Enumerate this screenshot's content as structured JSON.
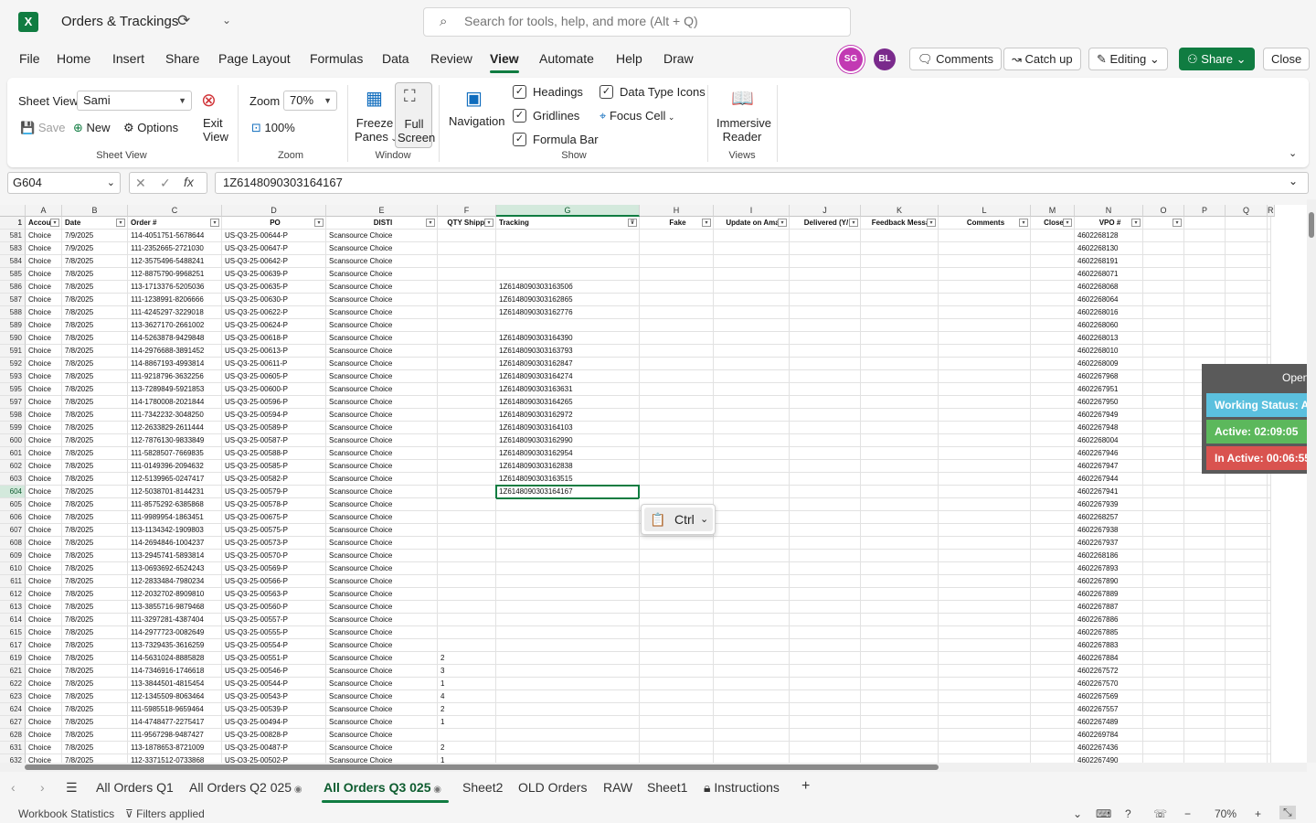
{
  "app": {
    "title": "Orders & Trackings",
    "search_placeholder": "Search for tools, help, and more (Alt + Q)"
  },
  "menu": [
    "File",
    "Home",
    "Insert",
    "Share",
    "Page Layout",
    "Formulas",
    "Data",
    "Review",
    "View",
    "Automate",
    "Help",
    "Draw"
  ],
  "header": {
    "avatar1": "SG",
    "avatar2": "BL",
    "comments": "Comments",
    "catchup": "Catch up",
    "editing": "Editing",
    "share": "Share",
    "close": "Close"
  },
  "ribbon": {
    "sheet_view_label": "Sheet View",
    "sheet_view_value": "Sami",
    "save": "Save",
    "new": "New",
    "options": "Options",
    "exit1": "Exit",
    "exit2": "View",
    "group_sheet_view": "Sheet View",
    "zoom_label": "Zoom",
    "zoom_value": "70%",
    "zoom_100": "100%",
    "group_zoom": "Zoom",
    "freeze1": "Freeze",
    "freeze2": "Panes",
    "full1": "Full",
    "full2": "Screen",
    "group_window": "Window",
    "navigation": "Navigation",
    "headings": "Headings",
    "gridlines": "Gridlines",
    "formula_bar": "Formula Bar",
    "data_type_icons": "Data Type Icons",
    "focus_cell": "Focus Cell",
    "group_show": "Show",
    "immersive1": "Immersive",
    "immersive2": "Reader",
    "group_views": "Views"
  },
  "formula_bar": {
    "name_box": "G604",
    "value": "1Z6148090303164167"
  },
  "grid": {
    "columns": [
      "A",
      "B",
      "C",
      "D",
      "E",
      "F",
      "G",
      "H",
      "I",
      "J",
      "K",
      "L",
      "M",
      "N",
      "O",
      "P",
      "Q",
      "R"
    ],
    "header_row_num": "1",
    "headers": [
      "Accou",
      "Date",
      "Order #",
      "PO",
      "DISTI",
      "QTY Shippe",
      "Tracking",
      "Fake",
      "Update on Ama",
      "Delivered (Y/",
      "Feedback Messa",
      "Comments",
      "Close",
      "VPO #",
      "",
      "",
      "",
      ""
    ],
    "active_row": "604",
    "rows": [
      [
        "581",
        "Choice",
        "7/9/2025",
        "114-4051751-5678644",
        "US-Q3-25-00644-P",
        "Scansource Choice",
        "",
        "",
        "4602268128"
      ],
      [
        "583",
        "Choice",
        "7/9/2025",
        "111-2352665-2721030",
        "US-Q3-25-00647-P",
        "Scansource Choice",
        "",
        "",
        "4602268130"
      ],
      [
        "584",
        "Choice",
        "7/8/2025",
        "112-3575496-5488241",
        "US-Q3-25-00642-P",
        "Scansource Choice",
        "",
        "",
        "4602268191"
      ],
      [
        "585",
        "Choice",
        "7/8/2025",
        "112-8875790-9968251",
        "US-Q3-25-00639-P",
        "Scansource Choice",
        "",
        "",
        "4602268071"
      ],
      [
        "586",
        "Choice",
        "7/8/2025",
        "113-1713376-5205036",
        "US-Q3-25-00635-P",
        "Scansource Choice",
        "",
        "1Z614809030316350б",
        "4602268068"
      ],
      [
        "587",
        "Choice",
        "7/8/2025",
        "111-1238991-8206666",
        "US-Q3-25-00630-P",
        "Scansource Choice",
        "",
        "1Z6148090303162865",
        "4602268064"
      ],
      [
        "588",
        "Choice",
        "7/8/2025",
        "111-4245297-3229018",
        "US-Q3-25-00622-P",
        "Scansource Choice",
        "",
        "1Z6148090303162776",
        "4602268016"
      ],
      [
        "589",
        "Choice",
        "7/8/2025",
        "113-3627170-2661002",
        "US-Q3-25-00624-P",
        "Scansource Choice",
        "",
        "",
        "4602268060"
      ],
      [
        "590",
        "Choice",
        "7/8/2025",
        "114-5263878-9429848",
        "US-Q3-25-00618-P",
        "Scansource Choice",
        "",
        "1Z6148090303164390",
        "4602268013"
      ],
      [
        "591",
        "Choice",
        "7/8/2025",
        "114-2976688-3891452",
        "US-Q3-25-00613-P",
        "Scansource Choice",
        "",
        "1Z6148090303163793",
        "4602268010"
      ],
      [
        "592",
        "Choice",
        "7/8/2025",
        "114-8867193-4993814",
        "US-Q3-25-00611-P",
        "Scansource Choice",
        "",
        "1Z6148090303162847",
        "4602268009"
      ],
      [
        "593",
        "Choice",
        "7/8/2025",
        "111-9218796-3632256",
        "US-Q3-25-00605-P",
        "Scansource Choice",
        "",
        "1Z6148090303164274",
        "4602267968"
      ],
      [
        "595",
        "Choice",
        "7/8/2025",
        "113-7289849-5921853",
        "US-Q3-25-00600-P",
        "Scansource Choice",
        "",
        "1Z6148090303163631",
        "4602267951"
      ],
      [
        "597",
        "Choice",
        "7/8/2025",
        "114-1780008-2021844",
        "US-Q3-25-00596-P",
        "Scansource Choice",
        "",
        "1Z6148090303164265",
        "4602267950"
      ],
      [
        "598",
        "Choice",
        "7/8/2025",
        "111-7342232-3048250",
        "US-Q3-25-00594-P",
        "Scansource Choice",
        "",
        "1Z6148090303162972",
        "4602267949"
      ],
      [
        "599",
        "Choice",
        "7/8/2025",
        "112-2633829-2611444",
        "US-Q3-25-00589-P",
        "Scansource Choice",
        "",
        "1Z6148090303164103",
        "4602267948"
      ],
      [
        "600",
        "Choice",
        "7/8/2025",
        "112-7876130-9833849",
        "US-Q3-25-00587-P",
        "Scansource Choice",
        "",
        "1Z6148090303162990",
        "4602268004"
      ],
      [
        "601",
        "Choice",
        "7/8/2025",
        "111-5828507-7669835",
        "US-Q3-25-00588-P",
        "Scansource Choice",
        "",
        "1Z6148090303162954",
        "4602267946"
      ],
      [
        "602",
        "Choice",
        "7/8/2025",
        "111-0149396-2094632",
        "US-Q3-25-00585-P",
        "Scansource Choice",
        "",
        "1Z6148090303162838",
        "4602267947"
      ],
      [
        "603",
        "Choice",
        "7/8/2025",
        "112-5139965-0247417",
        "US-Q3-25-00582-P",
        "Scansource Choice",
        "",
        "1Z6148090303163515",
        "4602267944"
      ],
      [
        "604",
        "Choice",
        "7/8/2025",
        "112-5038701-8144231",
        "US-Q3-25-00579-P",
        "Scansource Choice",
        "",
        "1Z6148090303164167",
        "4602267941"
      ],
      [
        "605",
        "Choice",
        "7/8/2025",
        "111-8575292-6385868",
        "US-Q3-25-00578-P",
        "Scansource Choice",
        "",
        "",
        "4602267939"
      ],
      [
        "606",
        "Choice",
        "7/8/2025",
        "111-9989954-1863451",
        "US-Q3-25-00675-P",
        "Scansource Choice",
        "",
        "",
        "4602268257"
      ],
      [
        "607",
        "Choice",
        "7/8/2025",
        "113-1134342-1909803",
        "US-Q3-25-00575-P",
        "Scansource Choice",
        "",
        "",
        "4602267938"
      ],
      [
        "608",
        "Choice",
        "7/8/2025",
        "114-2694846-1004237",
        "US-Q3-25-00573-P",
        "Scansource Choice",
        "",
        "",
        "4602267937"
      ],
      [
        "609",
        "Choice",
        "7/8/2025",
        "113-2945741-5893814",
        "US-Q3-25-00570-P",
        "Scansource Choice",
        "",
        "",
        "4602268186"
      ],
      [
        "610",
        "Choice",
        "7/8/2025",
        "113-0693692-6524243",
        "US-Q3-25-00569-P",
        "Scansource Choice",
        "",
        "",
        "4602267893"
      ],
      [
        "611",
        "Choice",
        "7/8/2025",
        "112-2833484-7980234",
        "US-Q3-25-00566-P",
        "Scansource Choice",
        "",
        "",
        "4602267890"
      ],
      [
        "612",
        "Choice",
        "7/8/2025",
        "112-2032702-8909810",
        "US-Q3-25-00563-P",
        "Scansource Choice",
        "",
        "",
        "4602267889"
      ],
      [
        "613",
        "Choice",
        "7/8/2025",
        "113-3855716-9879468",
        "US-Q3-25-00560-P",
        "Scansource Choice",
        "",
        "",
        "4602267887"
      ],
      [
        "614",
        "Choice",
        "7/8/2025",
        "111-3297281-4387404",
        "US-Q3-25-00557-P",
        "Scansource Choice",
        "",
        "",
        "4602267886"
      ],
      [
        "615",
        "Choice",
        "7/8/2025",
        "114-2977723-0082649",
        "US-Q3-25-00555-P",
        "Scansource Choice",
        "",
        "",
        "4602267885"
      ],
      [
        "617",
        "Choice",
        "7/8/2025",
        "113-7329435-3616259",
        "US-Q3-25-00554-P",
        "Scansource Choice",
        "",
        "",
        "4602267883"
      ],
      [
        "619",
        "Choice",
        "7/8/2025",
        "114-5631024-8885828",
        "US-Q3-25-00551-P",
        "Scansource Choice",
        "2",
        "",
        "4602267884"
      ],
      [
        "621",
        "Choice",
        "7/8/2025",
        "114-7346916-1746618",
        "US-Q3-25-00546-P",
        "Scansource Choice",
        "3",
        "",
        "4602267572"
      ],
      [
        "622",
        "Choice",
        "7/8/2025",
        "113-3844501-4815454",
        "US-Q3-25-00544-P",
        "Scansource Choice",
        "1",
        "",
        "4602267570"
      ],
      [
        "623",
        "Choice",
        "7/8/2025",
        "112-1345509-8063464",
        "US-Q3-25-00543-P",
        "Scansource Choice",
        "4",
        "",
        "4602267569"
      ],
      [
        "624",
        "Choice",
        "7/8/2025",
        "111-5985518-9659464",
        "US-Q3-25-00539-P",
        "Scansource Choice",
        "2",
        "",
        "4602267557"
      ],
      [
        "627",
        "Choice",
        "7/8/2025",
        "114-4748477-2275417",
        "US-Q3-25-00494-P",
        "Scansource Choice",
        "1",
        "",
        "4602267489"
      ],
      [
        "628",
        "Choice",
        "7/8/2025",
        "111-9567298-9487427",
        "US-Q3-25-00828-P",
        "Scansource Choice",
        "",
        "",
        "4602269784"
      ],
      [
        "631",
        "Choice",
        "7/8/2025",
        "113-1878653-8721009",
        "US-Q3-25-00487-P",
        "Scansource Choice",
        "2",
        "",
        "4602267436"
      ],
      [
        "632",
        "Choice",
        "7/8/2025",
        "112-3371512-0733868",
        "US-Q3-25-00502-P",
        "Scansource Choice",
        "1",
        "",
        "4602267490"
      ]
    ]
  },
  "paste_popup": {
    "label": "Ctrl"
  },
  "status_widget": {
    "open": "Open A",
    "working": "Working Status: Act",
    "active": "Active: 02:09:05",
    "inactive": "In Active: 00:06:55"
  },
  "colors": {
    "accent": "#107c41",
    "working": "#5bc0de",
    "active": "#5cb85c",
    "inactive": "#d9534f"
  },
  "sheets": [
    "All Orders Q1",
    "All Orders Q2 025",
    "All Orders Q3 025",
    "Sheet2",
    "OLD Orders",
    "RAW",
    "Sheet1",
    "Instructions"
  ],
  "statusbar": {
    "workbook_stats": "Workbook Statistics",
    "filters": "Filters applied",
    "zoom": "70%"
  }
}
